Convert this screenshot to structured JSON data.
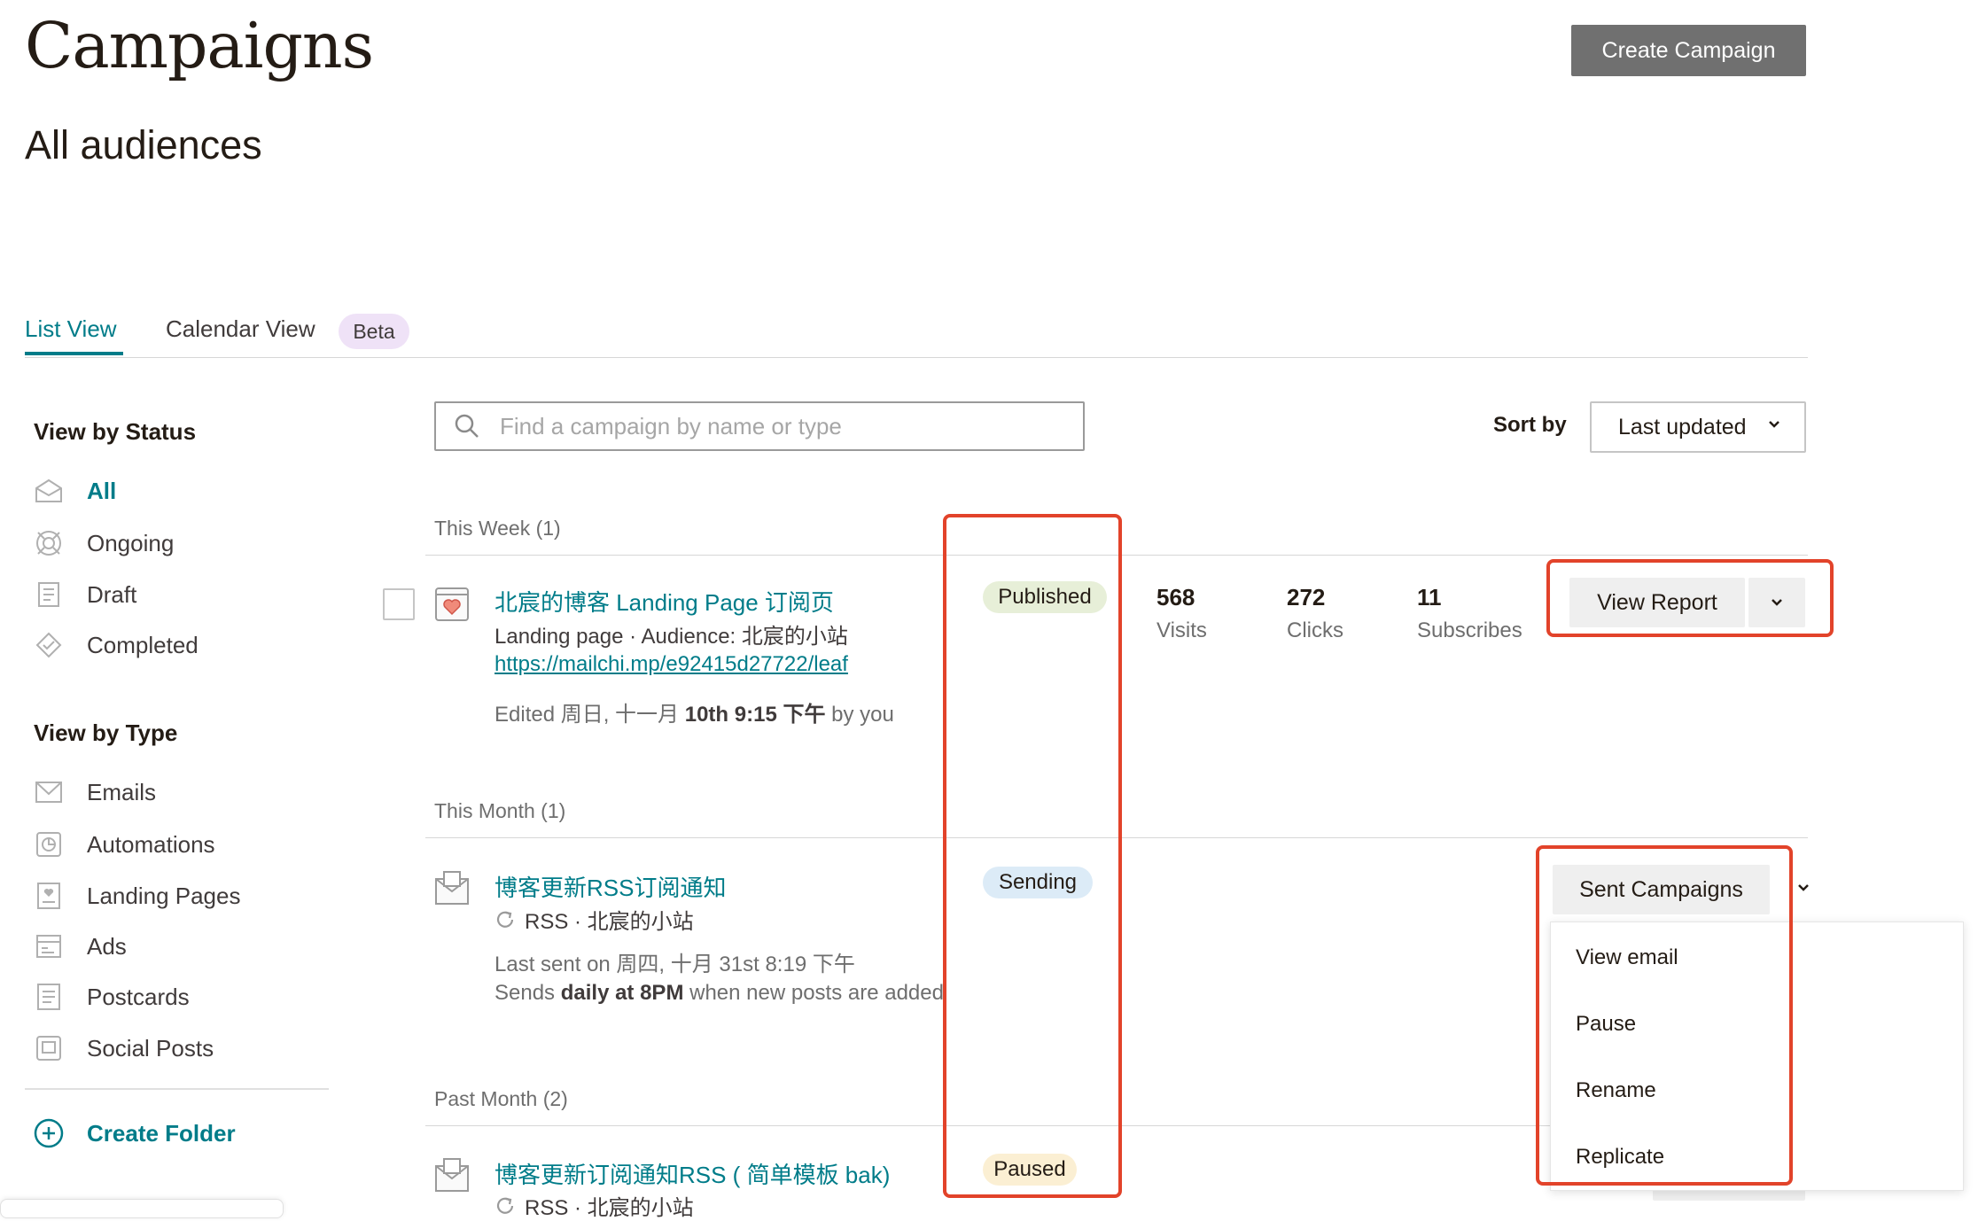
{
  "header": {
    "title": "Campaigns",
    "subtitle": "All audiences",
    "create_button": "Create Campaign"
  },
  "tabs": {
    "list": "List View",
    "calendar": "Calendar View",
    "beta_badge": "Beta"
  },
  "sidebar": {
    "status_heading": "View by Status",
    "status_items": [
      {
        "label": "All",
        "icon": "all-campaigns-icon",
        "active": true
      },
      {
        "label": "Ongoing",
        "icon": "ongoing-icon"
      },
      {
        "label": "Draft",
        "icon": "draft-icon"
      },
      {
        "label": "Completed",
        "icon": "completed-icon"
      }
    ],
    "type_heading": "View by Type",
    "type_items": [
      {
        "label": "Emails",
        "icon": "email-icon"
      },
      {
        "label": "Automations",
        "icon": "automation-icon"
      },
      {
        "label": "Landing Pages",
        "icon": "landing-page-icon"
      },
      {
        "label": "Ads",
        "icon": "ads-icon"
      },
      {
        "label": "Postcards",
        "icon": "postcard-icon"
      },
      {
        "label": "Social Posts",
        "icon": "social-post-icon"
      }
    ],
    "create_folder": "Create Folder"
  },
  "toolbar": {
    "search_placeholder": "Find a campaign by name or type",
    "sort_label": "Sort by",
    "sort_value": "Last updated"
  },
  "groups": {
    "this_week": "This Week (1)",
    "this_month": "This Month (1)",
    "past_month": "Past Month (2)"
  },
  "campaigns": {
    "landing": {
      "title": "北宸的博客 Landing Page 订阅页",
      "meta": "Landing page · Audience: 北宸的小站",
      "url": "https://mailchi.mp/e92415d27722/leaf",
      "edited_prefix": "Edited 周日, 十一月 ",
      "edited_bold": "10th 9:15 下午",
      "edited_suffix": " by you",
      "status": "Published",
      "stats": [
        {
          "value": "568",
          "label": "Visits"
        },
        {
          "value": "272",
          "label": "Clicks"
        },
        {
          "value": "11",
          "label": "Subscribes"
        }
      ],
      "action": "View Report"
    },
    "rss": {
      "title": "博客更新RSS订阅通知",
      "meta": "RSS · 北宸的小站",
      "last_sent": "Last sent on 周四, 十月 31st 8:19 下午",
      "sends_prefix": "Sends ",
      "sends_bold": "daily at 8PM",
      "sends_suffix": " when new posts are added",
      "status": "Sending",
      "action": "Sent Campaigns"
    },
    "rss_bak": {
      "title": "博客更新订阅通知RSS ( 简单模板 bak)",
      "meta": "RSS · 北宸的小站",
      "status": "Paused"
    }
  },
  "dropdown_menu": [
    "View email",
    "Pause",
    "Rename",
    "Replicate"
  ],
  "colors": {
    "accent": "#007c89",
    "highlight": "#e2432a",
    "primary_button": "#707070"
  }
}
